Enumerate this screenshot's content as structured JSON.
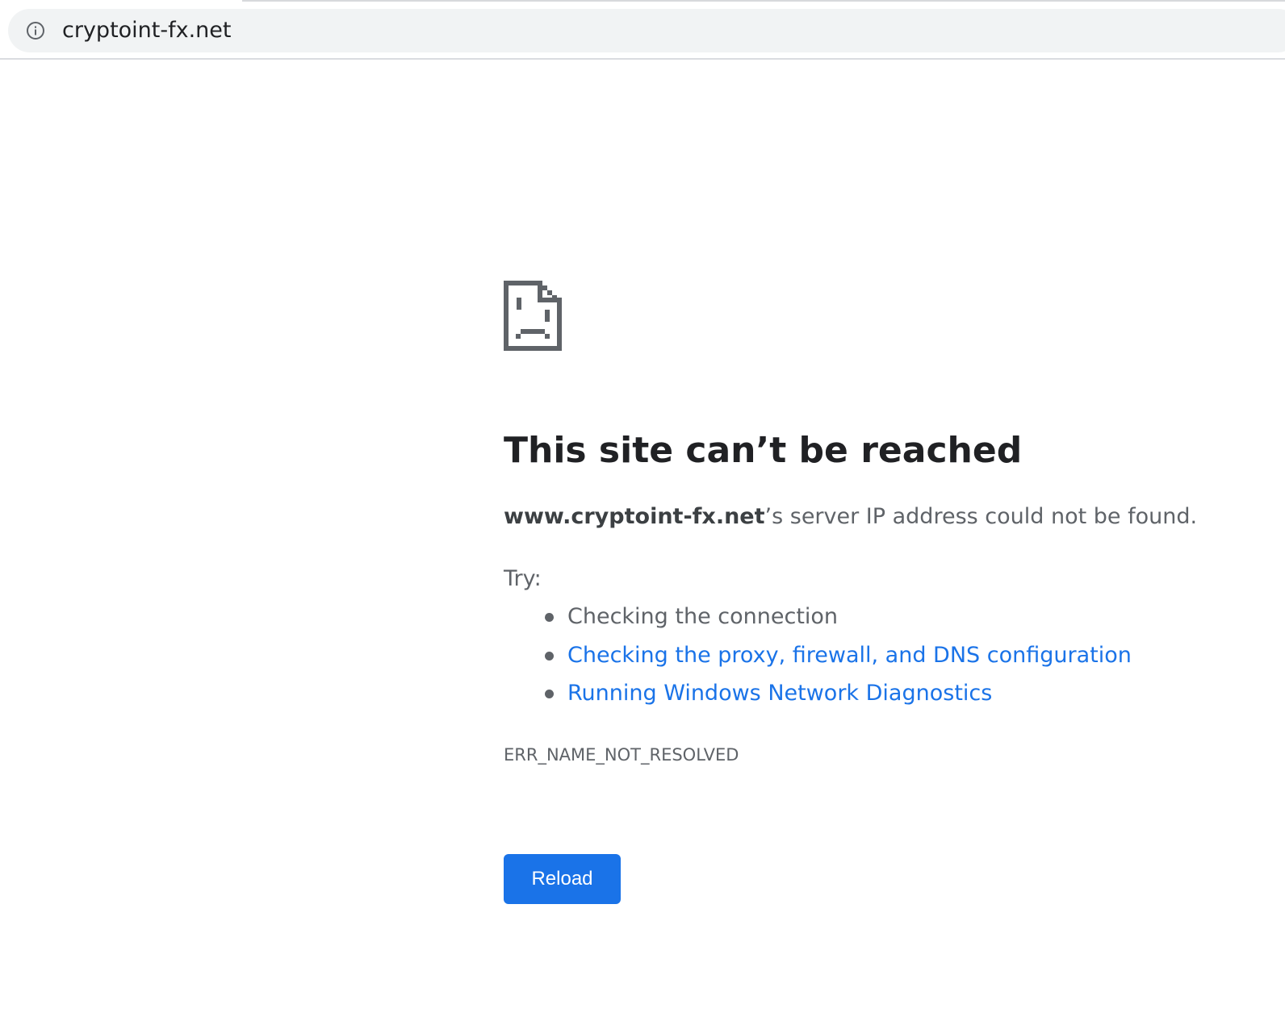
{
  "address_bar": {
    "url": "cryptoint-fx.net",
    "icon": "info-icon"
  },
  "error_page": {
    "icon": "sad-page-icon",
    "title": "This site can’t be reached",
    "summary_host": "www.cryptoint-fx.net",
    "summary_rest": "’s server IP address could not be found.",
    "try_label": "Try:",
    "suggestions": [
      {
        "text": "Checking the connection",
        "link": false
      },
      {
        "text": "Checking the proxy, firewall, and DNS configuration",
        "link": true
      },
      {
        "text": "Running Windows Network Diagnostics",
        "link": true
      }
    ],
    "error_code": "ERR_NAME_NOT_RESOLVED",
    "reload_label": "Reload"
  },
  "colors": {
    "link": "#1a73e8",
    "button": "#1a73e8",
    "text": "#202124",
    "secondary_text": "#5f6368"
  }
}
